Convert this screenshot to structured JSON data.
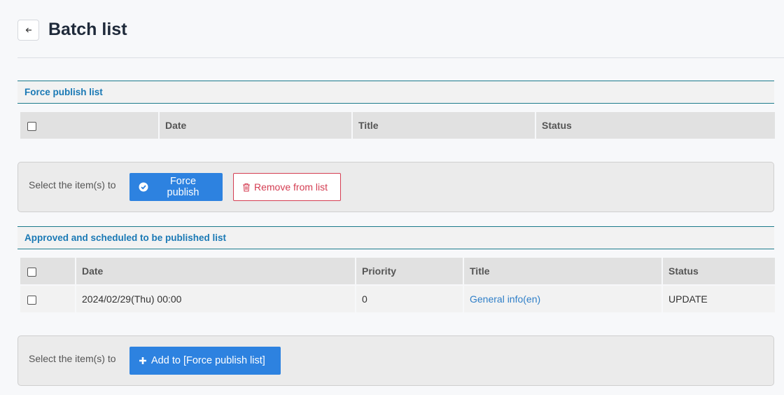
{
  "header": {
    "title": "Batch list"
  },
  "force_publish": {
    "section_title": "Force publish list",
    "columns": [
      "Date",
      "Title",
      "Status"
    ],
    "action_label": "Select the item(s) to",
    "force_publish_label": "Force publish",
    "remove_label": "Remove from list"
  },
  "approved": {
    "section_title": "Approved and scheduled to be published list",
    "columns": [
      "Date",
      "Priority",
      "Title",
      "Status"
    ],
    "rows": [
      {
        "date": "2024/02/29(Thu) 00:00",
        "priority": "0",
        "title": "General info(en)",
        "status": "UPDATE"
      }
    ],
    "action_label": "Select the item(s) to",
    "add_label": "Add to [Force publish list]"
  },
  "colors": {
    "accent": "#2d82e0",
    "danger": "#d43d52",
    "section_text": "#1a79b5",
    "section_border": "#1c7b8c"
  }
}
